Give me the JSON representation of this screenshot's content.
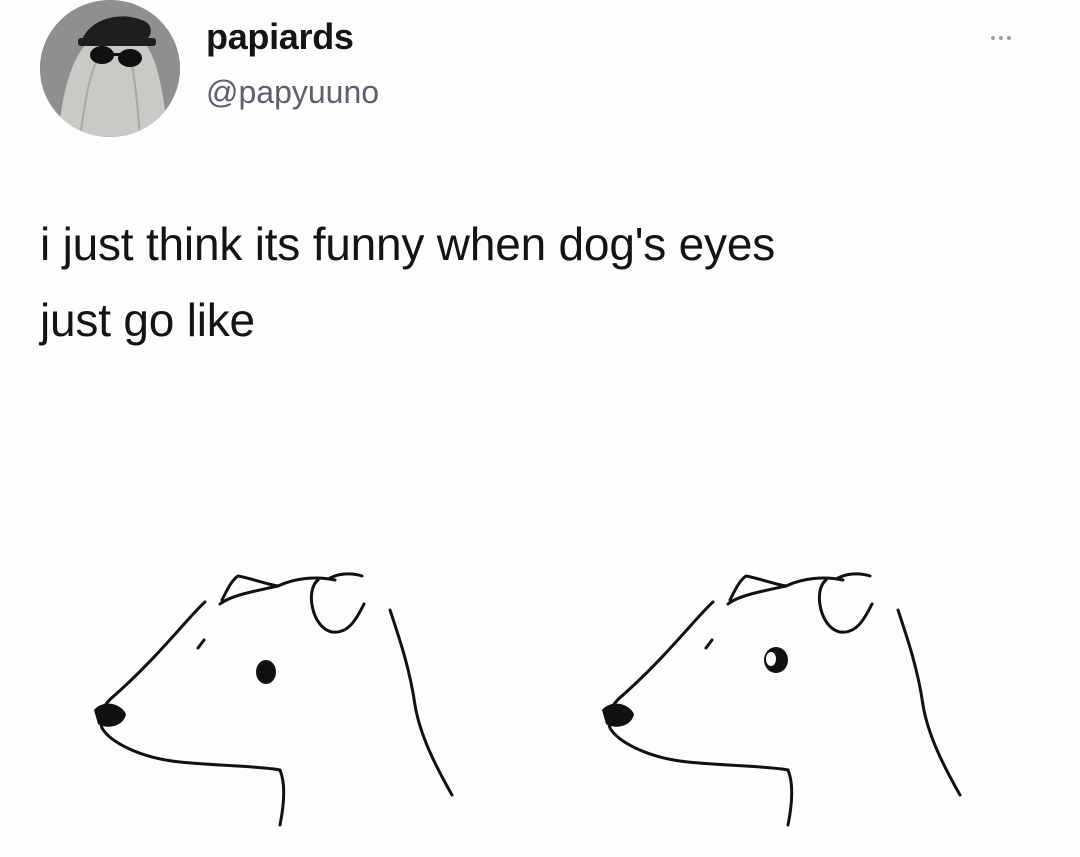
{
  "user": {
    "display_name": "papiards",
    "handle": "@papyuuno"
  },
  "tweet": {
    "text_lines": [
      "i just think its funny when dog's eyes",
      "just go like"
    ]
  },
  "icons": {
    "more": "more-horizontal-icon",
    "avatar": "avatar-ghost-sunglasses"
  },
  "colors": {
    "text": "#141414",
    "handle": "#5b6168",
    "background": "#fdfdfd"
  }
}
